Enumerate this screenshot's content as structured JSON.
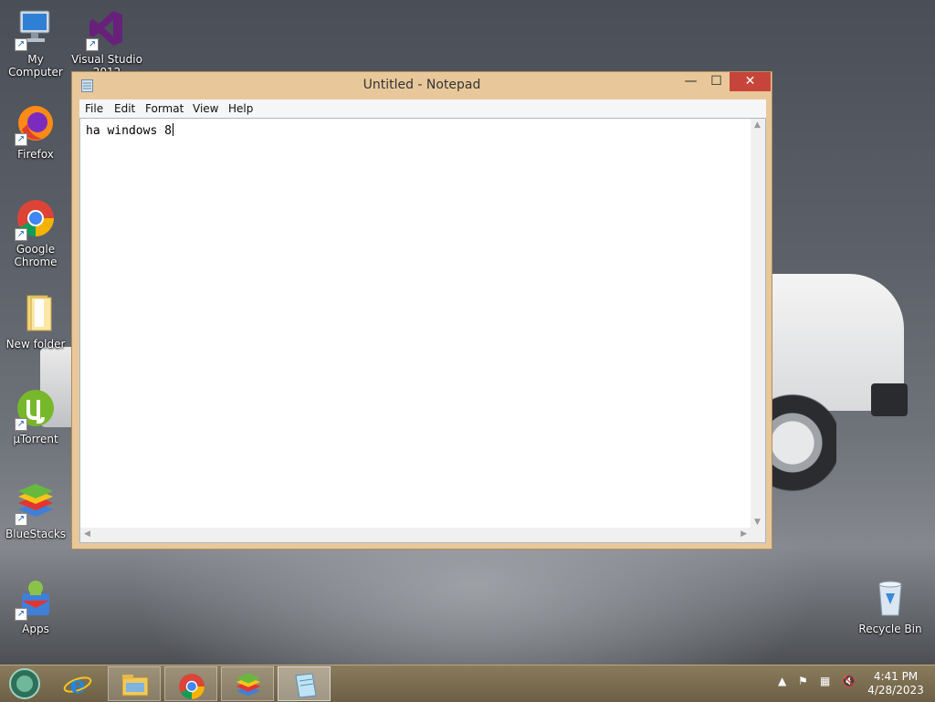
{
  "desktop": {
    "icons": [
      {
        "label": "My Computer",
        "icon": "computer-icon"
      },
      {
        "label": "Visual Studio 2012",
        "icon": "visual-studio-icon"
      },
      {
        "label": "Firefox",
        "icon": "firefox-icon"
      },
      {
        "label": "Google Chrome",
        "icon": "chrome-icon"
      },
      {
        "label": "New folder",
        "icon": "folder-icon"
      },
      {
        "label": "µTorrent",
        "icon": "utorrent-icon"
      },
      {
        "label": "BlueStacks",
        "icon": "bluestacks-icon"
      },
      {
        "label": "Apps",
        "icon": "apps-icon"
      },
      {
        "label": "Recycle Bin",
        "icon": "recycle-bin-icon"
      }
    ]
  },
  "notepad": {
    "title": "Untitled - Notepad",
    "menu": [
      "File",
      "Edit",
      "Format",
      "View",
      "Help"
    ],
    "content": "ha windows 8",
    "controls": {
      "minimize": "—",
      "maximize": "☐",
      "close": "✕"
    }
  },
  "taskbar": {
    "items": [
      "start-button",
      "internet-explorer",
      "file-explorer",
      "chrome",
      "bluestacks",
      "notepad"
    ],
    "clock": {
      "time": "4:41 PM",
      "date": "4/28/2023"
    },
    "tray": [
      "show-hidden-icons",
      "action-center-flag",
      "network",
      "volume-muted"
    ]
  },
  "colors": {
    "window_frame": "#e8c89a",
    "taskbar": "#6c5f45",
    "close_button": "#c7443a"
  }
}
